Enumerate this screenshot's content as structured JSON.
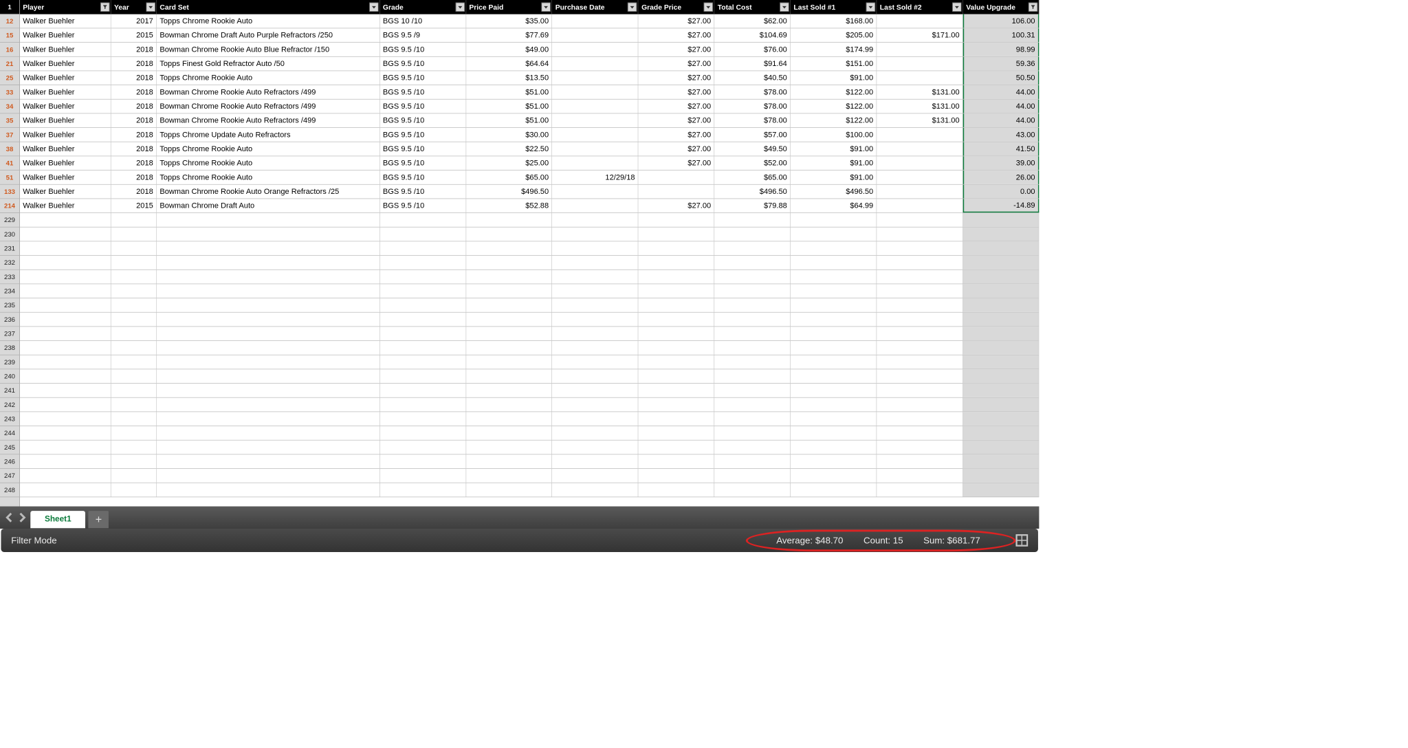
{
  "corner": "1",
  "columns": [
    {
      "key": "player",
      "label": "Player",
      "cls": "c-player",
      "filterActive": true,
      "align": "left"
    },
    {
      "key": "year",
      "label": "Year",
      "cls": "c-year",
      "filterActive": false,
      "align": "right"
    },
    {
      "key": "cardset",
      "label": "Card Set",
      "cls": "c-cardset",
      "filterActive": false,
      "align": "left"
    },
    {
      "key": "grade",
      "label": "Grade",
      "cls": "c-grade",
      "filterActive": false,
      "align": "left"
    },
    {
      "key": "price",
      "label": "Price Paid",
      "cls": "c-price",
      "filterActive": false,
      "align": "right"
    },
    {
      "key": "pdate",
      "label": "Purchase Date",
      "cls": "c-pdate",
      "filterActive": false,
      "align": "right"
    },
    {
      "key": "gprice",
      "label": "Grade Price",
      "cls": "c-gprice",
      "filterActive": false,
      "align": "right"
    },
    {
      "key": "tcost",
      "label": "Total Cost",
      "cls": "c-tcost",
      "filterActive": false,
      "align": "right"
    },
    {
      "key": "ls1",
      "label": "Last Sold #1",
      "cls": "c-ls1",
      "filterActive": false,
      "align": "right"
    },
    {
      "key": "ls2",
      "label": "Last Sold #2",
      "cls": "c-ls2",
      "filterActive": false,
      "align": "right"
    },
    {
      "key": "vup",
      "label": "Value Upgrade",
      "cls": "c-vup",
      "filterActive": true,
      "align": "right",
      "shaded": true,
      "selected": true
    }
  ],
  "rows": [
    {
      "num": "12",
      "player": "Walker Buehler",
      "year": "2017",
      "cardset": "Topps Chrome Rookie Auto",
      "grade": "BGS 10 /10",
      "price": "$35.00",
      "pdate": "",
      "gprice": "$27.00",
      "tcost": "$62.00",
      "ls1": "$168.00",
      "ls2": "",
      "vup": "106.00"
    },
    {
      "num": "15",
      "player": "Walker Buehler",
      "year": "2015",
      "cardset": "Bowman Chrome Draft Auto Purple Refractors /250",
      "grade": "BGS 9.5 /9",
      "price": "$77.69",
      "pdate": "",
      "gprice": "$27.00",
      "tcost": "$104.69",
      "ls1": "$205.00",
      "ls2": "$171.00",
      "vup": "100.31"
    },
    {
      "num": "16",
      "player": "Walker Buehler",
      "year": "2018",
      "cardset": "Bowman Chrome Rookie Auto Blue Refractor /150",
      "grade": "BGS 9.5 /10",
      "price": "$49.00",
      "pdate": "",
      "gprice": "$27.00",
      "tcost": "$76.00",
      "ls1": "$174.99",
      "ls2": "",
      "vup": "98.99"
    },
    {
      "num": "21",
      "player": "Walker Buehler",
      "year": "2018",
      "cardset": "Topps Finest Gold Refractor Auto /50",
      "grade": "BGS 9.5 /10",
      "price": "$64.64",
      "pdate": "",
      "gprice": "$27.00",
      "tcost": "$91.64",
      "ls1": "$151.00",
      "ls2": "",
      "vup": "59.36"
    },
    {
      "num": "25",
      "player": "Walker Buehler",
      "year": "2018",
      "cardset": "Topps Chrome Rookie Auto",
      "grade": "BGS 9.5 /10",
      "price": "$13.50",
      "pdate": "",
      "gprice": "$27.00",
      "tcost": "$40.50",
      "ls1": "$91.00",
      "ls2": "",
      "vup": "50.50"
    },
    {
      "num": "33",
      "player": "Walker Buehler",
      "year": "2018",
      "cardset": "Bowman Chrome Rookie Auto Refractors /499",
      "grade": "BGS 9.5 /10",
      "price": "$51.00",
      "pdate": "",
      "gprice": "$27.00",
      "tcost": "$78.00",
      "ls1": "$122.00",
      "ls2": "$131.00",
      "vup": "44.00"
    },
    {
      "num": "34",
      "player": "Walker Buehler",
      "year": "2018",
      "cardset": "Bowman Chrome Rookie Auto Refractors /499",
      "grade": "BGS 9.5 /10",
      "price": "$51.00",
      "pdate": "",
      "gprice": "$27.00",
      "tcost": "$78.00",
      "ls1": "$122.00",
      "ls2": "$131.00",
      "vup": "44.00"
    },
    {
      "num": "35",
      "player": "Walker Buehler",
      "year": "2018",
      "cardset": "Bowman Chrome Rookie Auto Refractors /499",
      "grade": "BGS 9.5 /10",
      "price": "$51.00",
      "pdate": "",
      "gprice": "$27.00",
      "tcost": "$78.00",
      "ls1": "$122.00",
      "ls2": "$131.00",
      "vup": "44.00"
    },
    {
      "num": "37",
      "player": "Walker Buehler",
      "year": "2018",
      "cardset": "Topps Chrome Update Auto Refractors",
      "grade": "BGS 9.5 /10",
      "price": "$30.00",
      "pdate": "",
      "gprice": "$27.00",
      "tcost": "$57.00",
      "ls1": "$100.00",
      "ls2": "",
      "vup": "43.00"
    },
    {
      "num": "38",
      "player": "Walker Buehler",
      "year": "2018",
      "cardset": "Topps Chrome Rookie Auto",
      "grade": "BGS 9.5 /10",
      "price": "$22.50",
      "pdate": "",
      "gprice": "$27.00",
      "tcost": "$49.50",
      "ls1": "$91.00",
      "ls2": "",
      "vup": "41.50"
    },
    {
      "num": "41",
      "player": "Walker Buehler",
      "year": "2018",
      "cardset": "Topps Chrome Rookie Auto",
      "grade": "BGS 9.5 /10",
      "price": "$25.00",
      "pdate": "",
      "gprice": "$27.00",
      "tcost": "$52.00",
      "ls1": "$91.00",
      "ls2": "",
      "vup": "39.00"
    },
    {
      "num": "51",
      "player": "Walker Buehler",
      "year": "2018",
      "cardset": "Topps Chrome Rookie Auto",
      "grade": "BGS 9.5 /10",
      "price": "$65.00",
      "pdate": "12/29/18",
      "gprice": "",
      "tcost": "$65.00",
      "ls1": "$91.00",
      "ls2": "",
      "vup": "26.00"
    },
    {
      "num": "133",
      "player": "Walker Buehler",
      "year": "2018",
      "cardset": "Bowman Chrome Rookie Auto Orange Refractors /25",
      "grade": "BGS 9.5 /10",
      "price": "$496.50",
      "pdate": "",
      "gprice": "",
      "tcost": "$496.50",
      "ls1": "$496.50",
      "ls2": "",
      "vup": "0.00"
    },
    {
      "num": "214",
      "player": "Walker Buehler",
      "year": "2015",
      "cardset": "Bowman Chrome Draft Auto",
      "grade": "BGS 9.5 /10",
      "price": "$52.88",
      "pdate": "",
      "gprice": "$27.00",
      "tcost": "$79.88",
      "ls1": "$64.99",
      "ls2": "",
      "vup": "-14.89"
    }
  ],
  "emptyRows": [
    "229",
    "230",
    "231",
    "232",
    "233",
    "234",
    "235",
    "236",
    "237",
    "238",
    "239",
    "240",
    "241",
    "242",
    "243",
    "244",
    "245",
    "246",
    "247",
    "248"
  ],
  "sheetTab": "Sheet1",
  "status": {
    "mode": "Filter Mode",
    "average": "Average: $48.70",
    "count": "Count: 15",
    "sum": "Sum: $681.77"
  }
}
